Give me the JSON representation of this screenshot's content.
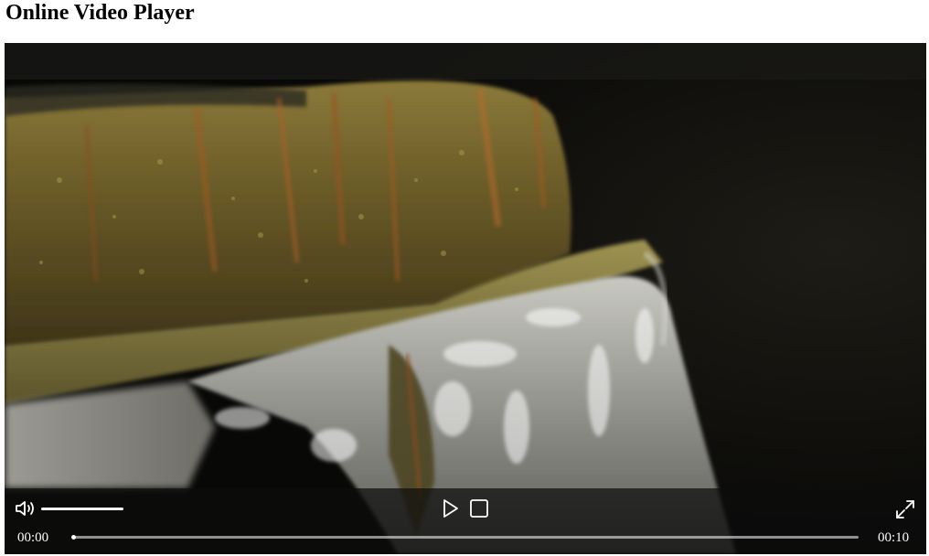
{
  "page": {
    "title": "Online Video Player"
  },
  "player": {
    "current_time": "00:00",
    "duration": "00:10",
    "progress_fraction": 0.0,
    "volume_fraction": 1.0,
    "controls": {
      "volume_icon": "speaker-volume-icon",
      "play_icon": "play-icon",
      "stop_icon": "stop-icon",
      "fullscreen_icon": "fullscreen-expand-icon"
    }
  },
  "colors": {
    "controls_text": "#ffffff",
    "controls_background": "#0c0c0c"
  }
}
